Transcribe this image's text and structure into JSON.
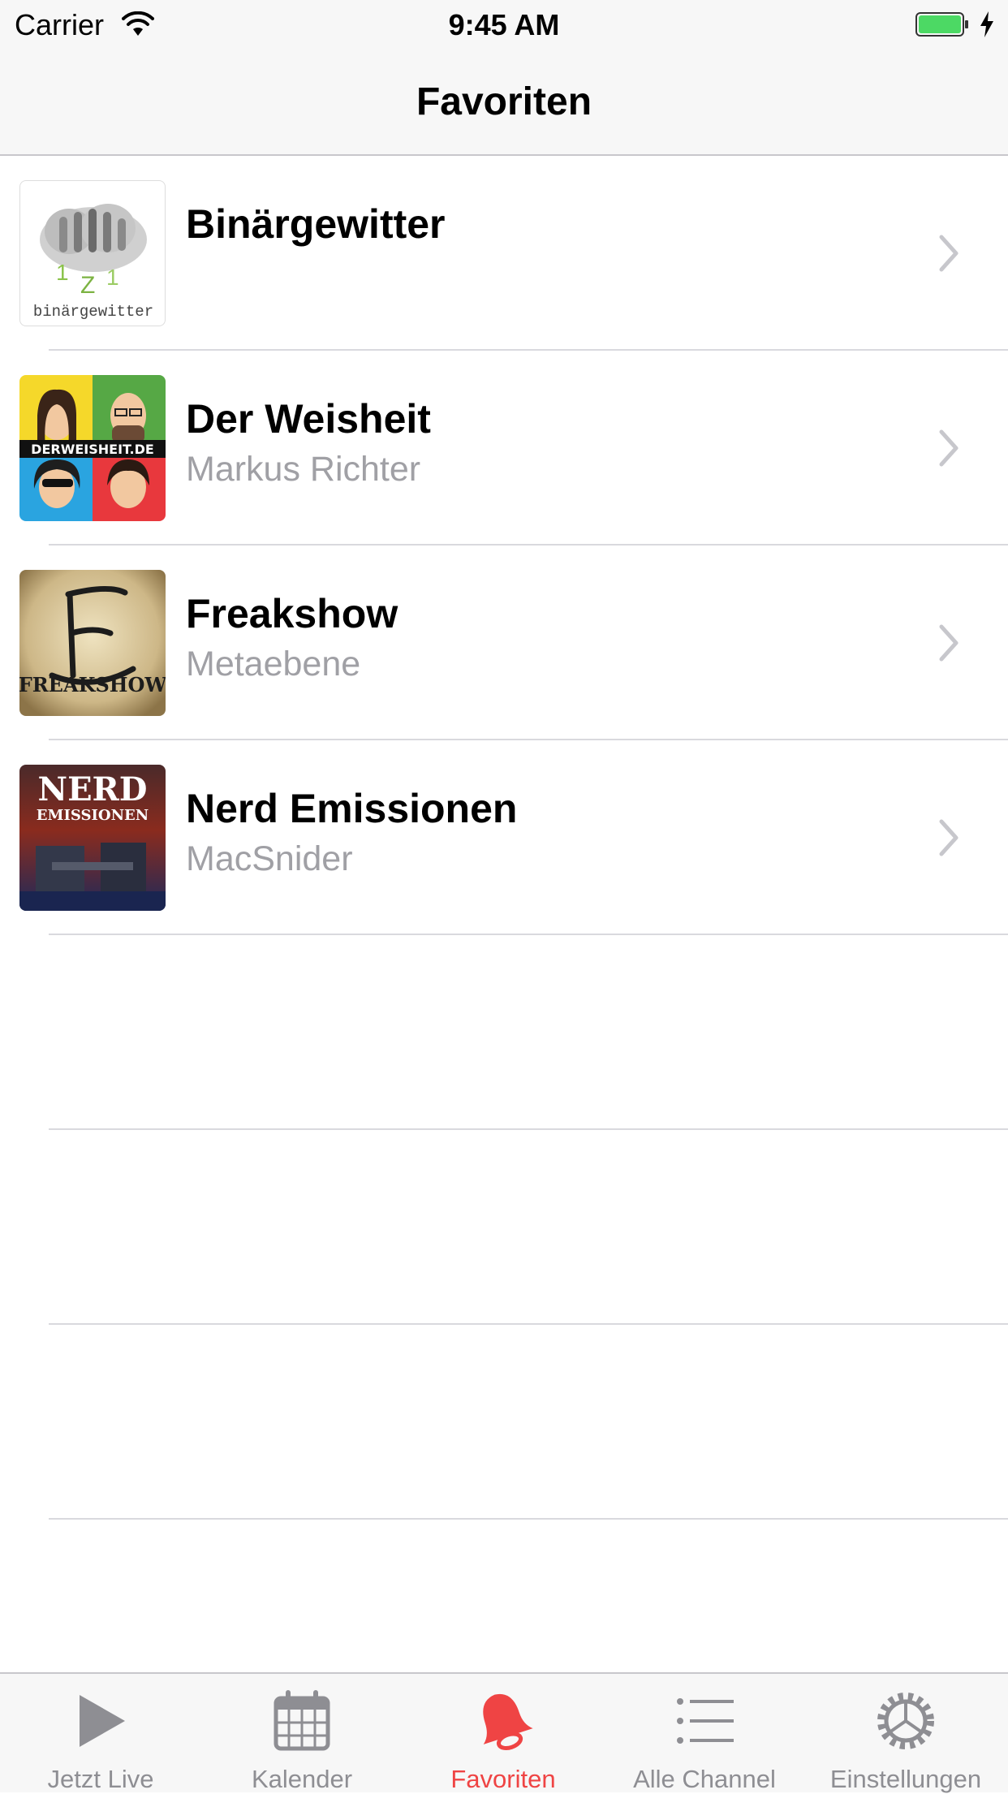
{
  "status_bar": {
    "carrier": "Carrier",
    "time": "9:45 AM"
  },
  "nav": {
    "title": "Favoriten"
  },
  "favorites": [
    {
      "title": "Binärgewitter",
      "subtitle": "",
      "thumb_text": "binärgewitter"
    },
    {
      "title": "Der Weisheit",
      "subtitle": "Markus Richter",
      "thumb_text": "DERWEISHEIT.DE"
    },
    {
      "title": "Freakshow",
      "subtitle": "Metaebene",
      "thumb_text": "FREAKSHOW"
    },
    {
      "title": "Nerd Emissionen",
      "subtitle": "MacSnider",
      "thumb_text_1": "NERD",
      "thumb_text_2": "EMISSIONEN"
    }
  ],
  "tabs": [
    {
      "label": "Jetzt Live",
      "icon": "play-icon"
    },
    {
      "label": "Kalender",
      "icon": "calendar-icon"
    },
    {
      "label": "Favoriten",
      "icon": "bell-icon",
      "active": true
    },
    {
      "label": "Alle Channel",
      "icon": "list-icon"
    },
    {
      "label": "Einstellungen",
      "icon": "gear-icon"
    }
  ],
  "colors": {
    "accent": "#ef4444",
    "inactive": "#8e8e93",
    "battery": "#4cd964"
  }
}
